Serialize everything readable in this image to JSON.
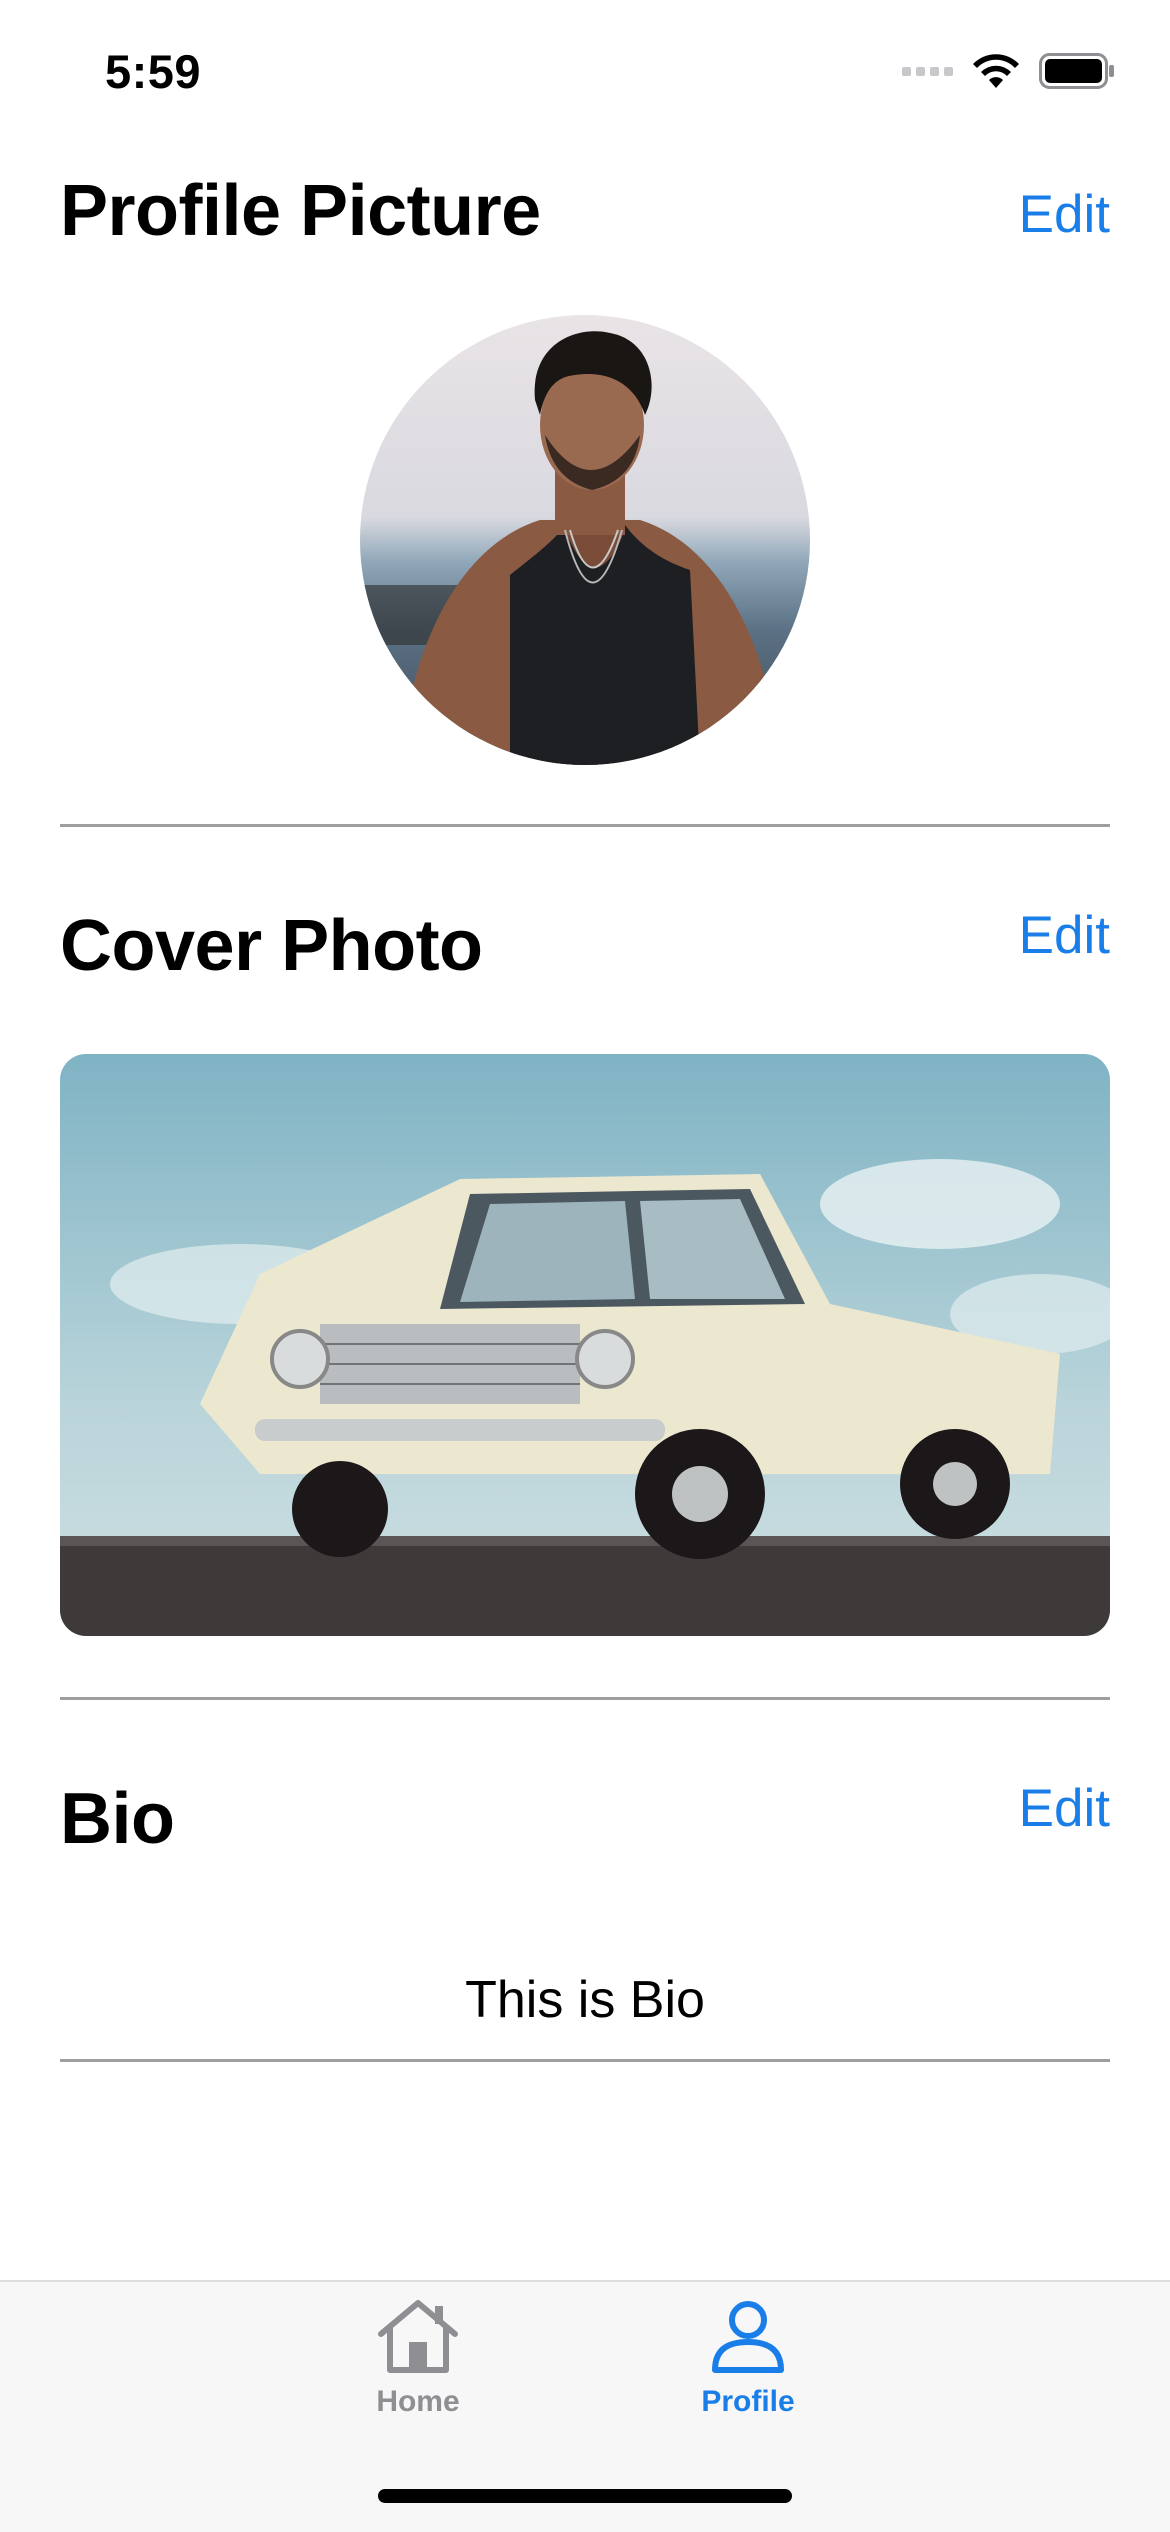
{
  "status_bar": {
    "time": "5:59",
    "icons": [
      "cellular-signal-icon",
      "wifi-icon",
      "battery-icon"
    ]
  },
  "profile_picture": {
    "title": "Profile Picture",
    "edit_label": "Edit",
    "image": "profile-photo-man-tank-top-seaside"
  },
  "cover_photo": {
    "title": "Cover Photo",
    "edit_label": "Edit",
    "image": "cover-photo-white-vintage-sedan"
  },
  "bio": {
    "title": "Bio",
    "edit_label": "Edit",
    "text": "This is Bio"
  },
  "tab_bar": {
    "tabs": [
      {
        "label": "Home",
        "icon": "house-icon",
        "selected": false
      },
      {
        "label": "Profile",
        "icon": "person-icon",
        "selected": true
      }
    ]
  },
  "colors": {
    "accent": "#1a7ee8",
    "inactive": "#8e8e93",
    "divider": "#9e9e9e",
    "tab_bar_bg": "#f7f7f7"
  }
}
